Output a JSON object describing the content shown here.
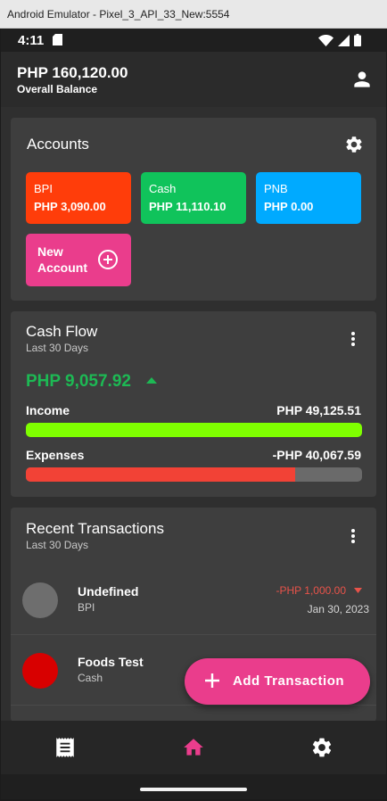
{
  "window": {
    "title": "Android Emulator - Pixel_3_API_33_New:5554"
  },
  "status_bar": {
    "time": "4:11"
  },
  "app_bar": {
    "balance": "PHP 160,120.00",
    "balance_label": "Overall Balance",
    "icon": "account-icon"
  },
  "accounts": {
    "title": "Accounts",
    "settings_icon": "gear-icon",
    "items": [
      {
        "name": "BPI",
        "amount": "PHP 3,090.00",
        "color": "#ff3d0a"
      },
      {
        "name": "Cash",
        "amount": "PHP 11,110.10",
        "color": "#10c35b"
      },
      {
        "name": "PNB",
        "amount": "PHP 0.00",
        "color": "#00aaff"
      }
    ],
    "new_account": {
      "label": "New Account",
      "color": "#ea3d8c"
    }
  },
  "cash_flow": {
    "title": "Cash Flow",
    "subtitle": "Last 30 Days",
    "net": "PHP 9,057.92",
    "net_color": "#1db954",
    "income": {
      "label": "Income",
      "value": "PHP 49,125.51",
      "fill": 1.0,
      "color": "#7fff00"
    },
    "expenses": {
      "label": "Expenses",
      "value": "-PHP 40,067.59",
      "fill": 0.8,
      "color": "#f24236"
    }
  },
  "recent_transactions": {
    "title": "Recent Transactions",
    "subtitle": "Last 30 Days",
    "items": [
      {
        "category": "Undefined",
        "account": "BPI",
        "amount": "-PHP 1,000.00",
        "date": "Jan 30, 2023",
        "color": "#6e6e6e"
      },
      {
        "category": "Foods Test",
        "account": "Cash",
        "amount": "",
        "date": "",
        "color": "#d80000"
      }
    ]
  },
  "fab": {
    "label": "Add Transaction"
  },
  "bottom_nav": [
    {
      "name": "transactions",
      "icon": "receipt-icon",
      "color": "#ffffff"
    },
    {
      "name": "home",
      "icon": "home-icon",
      "color": "#ea3d8c"
    },
    {
      "name": "settings",
      "icon": "gear-icon",
      "color": "#ffffff"
    }
  ]
}
